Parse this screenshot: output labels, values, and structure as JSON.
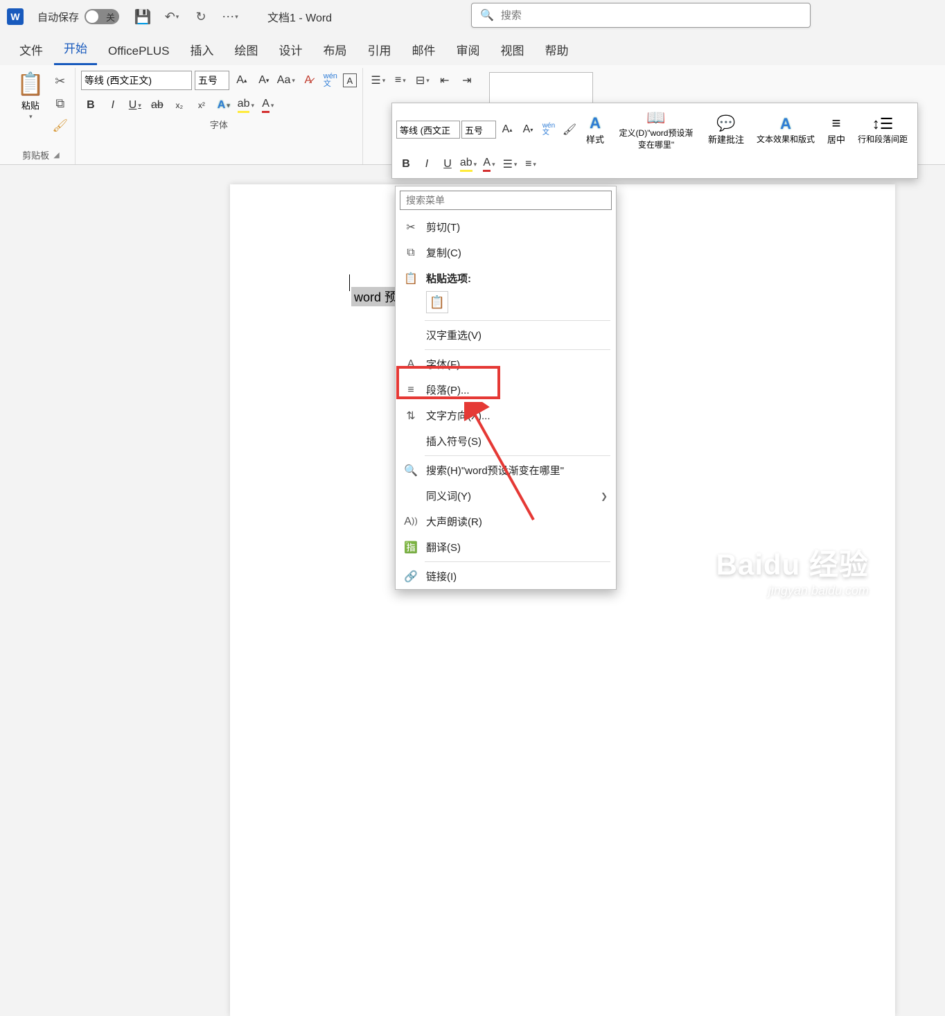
{
  "title_bar": {
    "autosave_label": "自动保存",
    "toggle_state": "关",
    "doc_title": "文档1  -  Word",
    "search_placeholder": "搜索"
  },
  "tabs": {
    "file": "文件",
    "home": "开始",
    "officeplus": "OfficePLUS",
    "insert": "插入",
    "draw": "绘图",
    "design": "设计",
    "layout": "布局",
    "references": "引用",
    "mailings": "邮件",
    "review": "审阅",
    "view": "视图",
    "help": "帮助"
  },
  "ribbon": {
    "clipboard": {
      "label": "剪贴板",
      "paste": "粘贴"
    },
    "font": {
      "label": "字体",
      "name": "等线 (西文正文)",
      "size": "五号"
    }
  },
  "mini_toolbar": {
    "font_name": "等线 (西文正",
    "font_size": "五号",
    "styles": "样式",
    "define": "定义(D)\"word预设渐变在哪里\"",
    "new_comment": "新建批注",
    "text_effect": "文本效果和版式",
    "center": "居中",
    "line_spacing": "行和段落间距"
  },
  "document": {
    "selected_text": "word 预"
  },
  "context_menu": {
    "search_placeholder": "搜索菜单",
    "cut": "剪切(T)",
    "copy": "复制(C)",
    "paste_options": "粘贴选项:",
    "hanzi_reselect": "汉字重选(V)",
    "font": "字体(F)...",
    "paragraph": "段落(P)...",
    "text_direction": "文字方向(X)...",
    "insert_symbol": "插入符号(S)",
    "search_item": "搜索(H)\"word预设渐变在哪里\"",
    "synonyms": "同义词(Y)",
    "read_aloud": "大声朗读(R)",
    "translate": "翻译(S)",
    "link": "链接(I)"
  },
  "watermark": {
    "main": "Baidu 经验",
    "sub": "jingyan.baidu.com"
  }
}
